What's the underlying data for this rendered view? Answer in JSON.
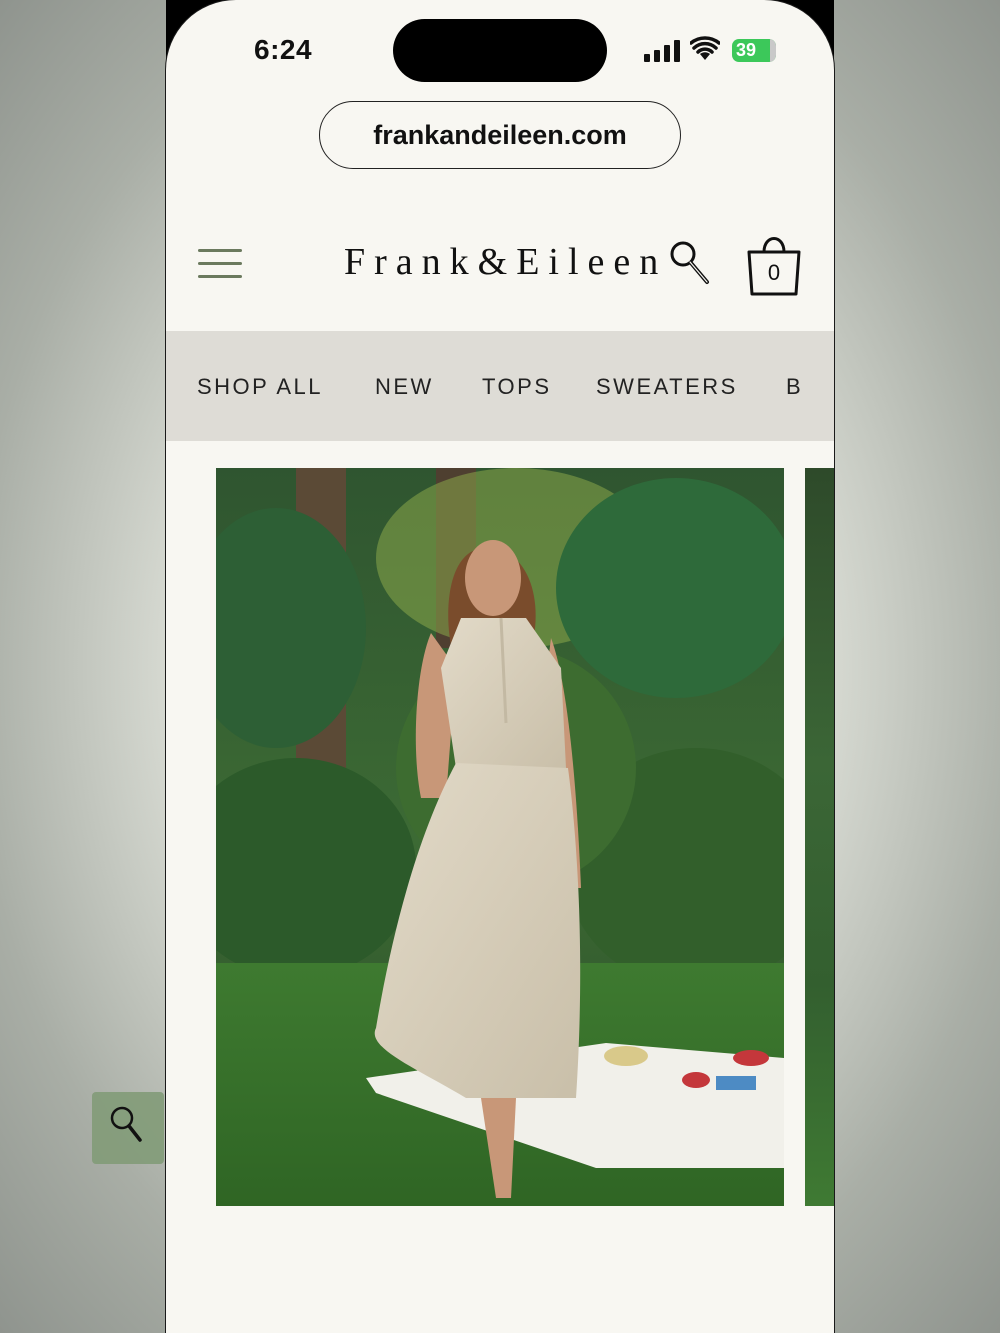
{
  "status_bar": {
    "time": "6:24",
    "battery": "39"
  },
  "browser": {
    "url": "frankandeileen.com"
  },
  "header": {
    "logo": "Frank&Eileen",
    "bag_count": "0",
    "menu_icon": "hamburger-icon",
    "search_icon": "magnifier-icon",
    "bag_icon": "shopping-bag-icon"
  },
  "nav": {
    "items": [
      "SHOP ALL",
      "NEW",
      "TOPS",
      "SWEATERS",
      "B"
    ]
  },
  "hero": {
    "zoom_icon": "magnifier-icon"
  },
  "colors": {
    "page_bg": "#f8f7f2",
    "nav_bg": "#dedcd6",
    "menu_accent": "#6b7a5e",
    "zoom_button": "#829b78",
    "battery_green": "#3cc85a"
  }
}
